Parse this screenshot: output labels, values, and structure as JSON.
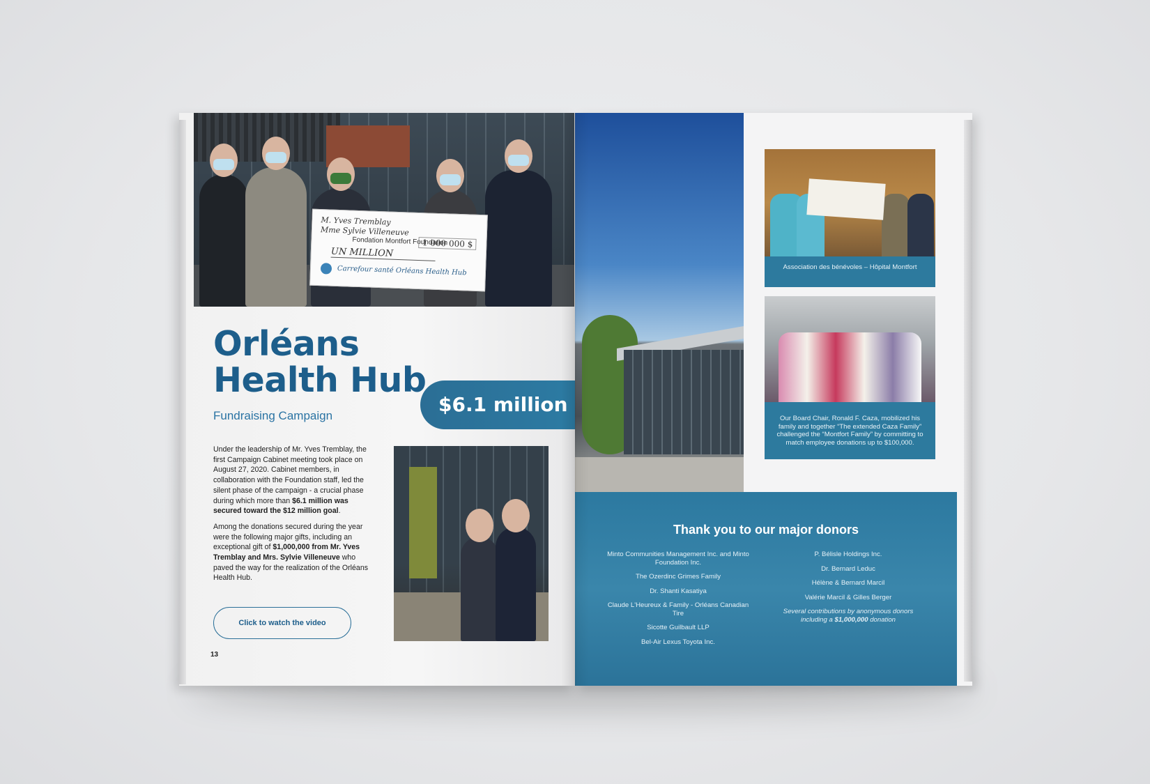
{
  "left_page": {
    "title_line1": "Orléans",
    "title_line2": "Health Hub",
    "subtitle": "Fundraising Campaign",
    "amount_pill": "$6.1 million",
    "paragraph1": {
      "text_a": "Under the leadership of Mr. Yves Tremblay, the first Campaign Cabinet meeting took place on August 27, 2020.  Cabinet members, in collaboration with the Foundation staff, led the silent phase of the campaign - a crucial phase during which more than ",
      "bold": "$6.1 million was secured toward the $12 million goal",
      "text_b": "."
    },
    "paragraph2": {
      "text_a": "Among the donations secured during the year were the following major gifts, including an exceptional gift of ",
      "bold": "$1,000,000 from Mr. Yves Tremblay and Mrs. Sylvie Villeneuve",
      "text_b": " who paved the way for the realization of the Orléans Health Hub."
    },
    "video_button": "Click to watch the video",
    "page_number": "13",
    "cheque": {
      "line1": "M. Yves Tremblay",
      "line2": "Mme Sylvie Villeneuve",
      "foundation": "Fondation Montfort Foundation",
      "amount": "1 000 000 $",
      "words": "UN  MILLION",
      "payee": "Carrefour santé Orléans Health Hub"
    }
  },
  "right_page": {
    "caption1": "Association des bénévoles – Hôpital Montfort",
    "caption2": "Our Board Chair, Ronald F. Caza, mobilized his family and together “The extended Caza Family” challenged the “Montfort Family” by committing to match employee donations up to $100,000.",
    "donors_title": "Thank you to our major donors",
    "donors_col1": [
      "Minto Communities Management Inc. and Minto Foundation Inc.",
      "The Ozerdinc Grimes Family",
      "Dr. Shanti Kasatiya",
      "Claude L'Heureux & Family - Orléans Canadian Tire",
      "Sicotte Guilbault LLP",
      "Bel-Air Lexus Toyota Inc."
    ],
    "donors_col2": [
      "P. Bélisle Holdings Inc.",
      "Dr. Bernard Leduc",
      "Hélène & Bernard Marcil",
      "Valérie Marcil & Gilles Berger"
    ],
    "donors_note_a": "Several contributions by anonymous donors including a ",
    "donors_note_bold": "$1,000,000",
    "donors_note_b": " donation"
  },
  "colors": {
    "brand_blue": "#1d5e8b",
    "panel_blue": "#2c79a0"
  }
}
